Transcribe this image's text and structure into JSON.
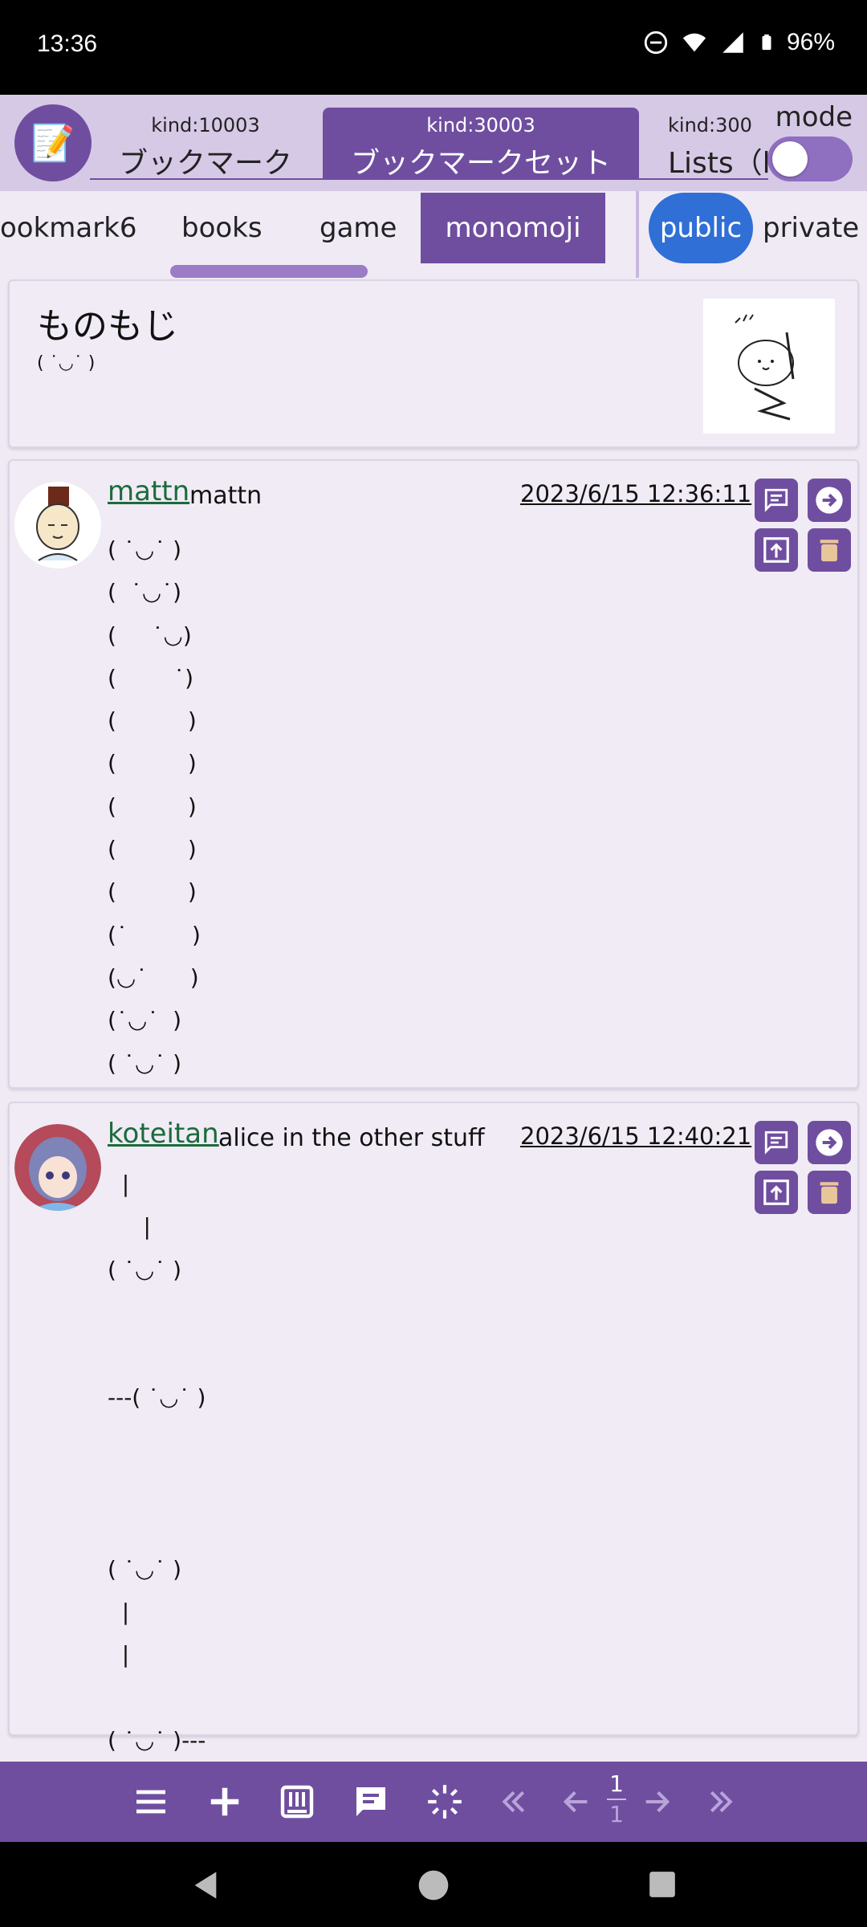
{
  "status_bar": {
    "time": "13:36",
    "battery": "96%",
    "icons": [
      "dnd-icon",
      "wifi-icon",
      "signal-icon",
      "battery-icon"
    ]
  },
  "header": {
    "app_icon": "memo-icon",
    "kind_tabs": [
      {
        "kind": "kind:10003",
        "label": "ブックマーク"
      },
      {
        "kind": "kind:30003",
        "label": "ブックマークセット"
      },
      {
        "kind": "kind:300",
        "label": "Lists（l"
      }
    ],
    "mode_label": "mode",
    "mode_toggle_on": false
  },
  "list_tabs": {
    "items": [
      "ookmark6",
      "books",
      "game",
      "monomoji"
    ],
    "active": "monomoji",
    "visibility": [
      "public",
      "private"
    ],
    "visibility_active": "public"
  },
  "list_header": {
    "title": "ものもじ",
    "subtitle": "( ˙◡˙ )"
  },
  "posts": [
    {
      "username": "mattn",
      "display_name": "mattn",
      "timestamp": "2023/6/15 12:36:11",
      "content": "( ˙◡˙ )\n(  ˙◡˙)\n(     ˙◡)\n(        ˙)\n(          )\n(          )\n(          )\n(          )\n(          )\n(˙         )\n(◡˙      )\n(˙◡˙  )\n( ˙◡˙ )"
    },
    {
      "username": "koteitan",
      "display_name": "alice in the other stuff",
      "timestamp": "2023/6/15 12:40:21",
      "content": "  |\n     |\n( ˙◡˙ )\n\n\n---( ˙◡˙ )\n\n\n\n( ˙◡˙ )\n  |\n  |\n\n( ˙◡˙ )---"
    }
  ],
  "toolbar": {
    "icons": [
      "menu-icon",
      "add-icon",
      "keyboard-icon",
      "chat-icon",
      "loading-icon",
      "first-page-icon",
      "prev-page-icon",
      "next-page-icon",
      "last-page-icon"
    ],
    "page_current": "1",
    "page_total": "1"
  },
  "colors": {
    "accent": "#6f4ea0",
    "header_bg": "#d6c9e6",
    "public_pill": "#2f6fd6",
    "link_green": "#1c6b3a",
    "page_bg": "#efeaf4"
  }
}
